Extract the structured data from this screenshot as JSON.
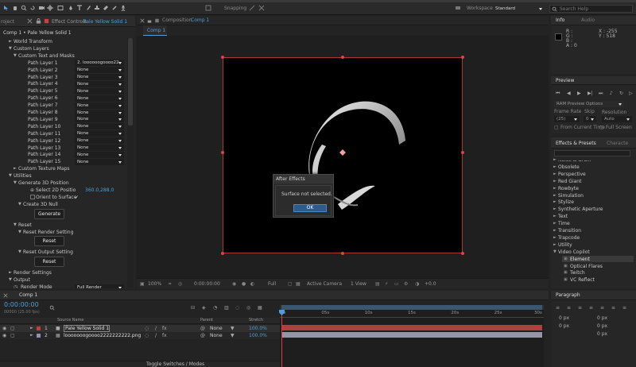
{
  "effect_controls": {
    "tab_prefix": "Effect Controls",
    "tab_layer": "Pale Yellow Solid 1",
    "breadcrumb": "Comp 1 • Pale Yellow Solid 1",
    "items": [
      {
        "label": "World Transform",
        "level": 1,
        "arrow": "►"
      },
      {
        "label": "Custom Layers",
        "level": 1,
        "arrow": "▼"
      },
      {
        "label": "Custom Text and Masks",
        "level": 2,
        "arrow": "▼"
      }
    ],
    "path_layers": [
      {
        "label": "Path Layer 1",
        "value": "2. loooooogoooo22"
      },
      {
        "label": "Path Layer 2",
        "value": "None"
      },
      {
        "label": "Path Layer 3",
        "value": "None"
      },
      {
        "label": "Path Layer 4",
        "value": "None"
      },
      {
        "label": "Path Layer 5",
        "value": "None"
      },
      {
        "label": "Path Layer 6",
        "value": "None"
      },
      {
        "label": "Path Layer 7",
        "value": "None"
      },
      {
        "label": "Path Layer 8",
        "value": "None"
      },
      {
        "label": "Path Layer 9",
        "value": "None"
      },
      {
        "label": "Path Layer 10",
        "value": "None"
      },
      {
        "label": "Path Layer 11",
        "value": "None"
      },
      {
        "label": "Path Layer 12",
        "value": "None"
      },
      {
        "label": "Path Layer 13",
        "value": "None"
      },
      {
        "label": "Path Layer 14",
        "value": "None"
      },
      {
        "label": "Path Layer 15",
        "value": "None"
      }
    ],
    "custom_texture_maps": "Custom Texture Maps",
    "utilities": "Utilities",
    "generate_3d_position": "Generate 3D Position",
    "select_2d_position": "Select 2D Positio",
    "select_2d_value": "360.0,288.0",
    "orient_to_surface": "Orient to Surface",
    "orient_check": "✓",
    "create_3d_null": "Create 3D Null",
    "generate_button": "Generate",
    "reset": "Reset",
    "reset_render_setting": "Reset Render Setting",
    "reset_button_1": "Reset",
    "reset_output_setting": "Reset Output Setting",
    "reset_button_2": "Reset",
    "render_settings": "Render Settings",
    "output": "Output",
    "render_mode_label": "Render Mode",
    "render_mode_value": "Full Render"
  },
  "composition": {
    "tab_prefix": "Composition",
    "tab_name": "Comp 1",
    "sub_tab": "Comp 1",
    "zoom": "100%",
    "timecode": "0:00:00:00",
    "resolution": "Full",
    "camera": "Active Camera",
    "views": "1 View",
    "exposure": "+0.0"
  },
  "dialog": {
    "title": "After Effects",
    "message": "Surface not selected.",
    "ok": "OK"
  },
  "top_bar": {
    "menu": "File  Edit  Composition  Layer  Effect  Animation  View  Window  Help",
    "snapping": "Snapping",
    "workspace_label": "Workspace:",
    "workspace_value": "Standard",
    "search_placeholder": "Search Help"
  },
  "info": {
    "tab": "Info",
    "tab2": "Audio",
    "r": "R :",
    "g": "G :",
    "b": "B :",
    "a": "A : 0",
    "x": "X : -255",
    "y": "Y : 518"
  },
  "preview": {
    "tab": "Preview",
    "ram_options": "RAM Preview Options",
    "frame_rate": "Frame Rate",
    "skip": "Skip",
    "resolution": "Resolution",
    "frame_rate_value": "(25)",
    "skip_value": "0",
    "resolution_value": "Auto",
    "from_current": "From Current Time",
    "full_screen": "Full Screen"
  },
  "effects_presets": {
    "tab": "Effects & Presets",
    "tab2": "Characte",
    "search_placeholder": "",
    "categories": [
      "Noise & Grain",
      "Obsolete",
      "Perspective",
      "Red Giant",
      "Rowbyte",
      "Simulation",
      "Stylize",
      "Synthetic Aperture",
      "Text",
      "Time",
      "Transition",
      "Trapcode",
      "Utility",
      "Video Copilot"
    ],
    "sub_items": [
      "Element",
      "Optical Flares",
      "Twitch",
      "VC Reflect"
    ]
  },
  "paragraph": {
    "tab": "Paragraph",
    "values": [
      "0 px",
      "0 px",
      "0 px",
      "0 px",
      "0 px"
    ]
  },
  "timeline": {
    "tab": "Comp 1",
    "timecode": "0:00:00:00",
    "fps": "00000 (25.00 fps)",
    "col_source": "Source Name",
    "col_parent": "Parent",
    "col_stretch": "Stretch",
    "ruler": [
      "0s",
      "05s",
      "10s",
      "15s",
      "20s",
      "25s",
      "30s"
    ],
    "layers": [
      {
        "num": "1",
        "name": "Pale Yellow Solid 1",
        "parent": "None",
        "stretch": "100.0%",
        "color": "#c83a3a",
        "bar": "#b04040"
      },
      {
        "num": "2",
        "name": "looooooogoooo2222222222.png",
        "parent": "None",
        "stretch": "100.0%",
        "color": "#8f90b8",
        "bar": "#9496a8"
      }
    ],
    "toggle": "Toggle Switches / Modes"
  }
}
